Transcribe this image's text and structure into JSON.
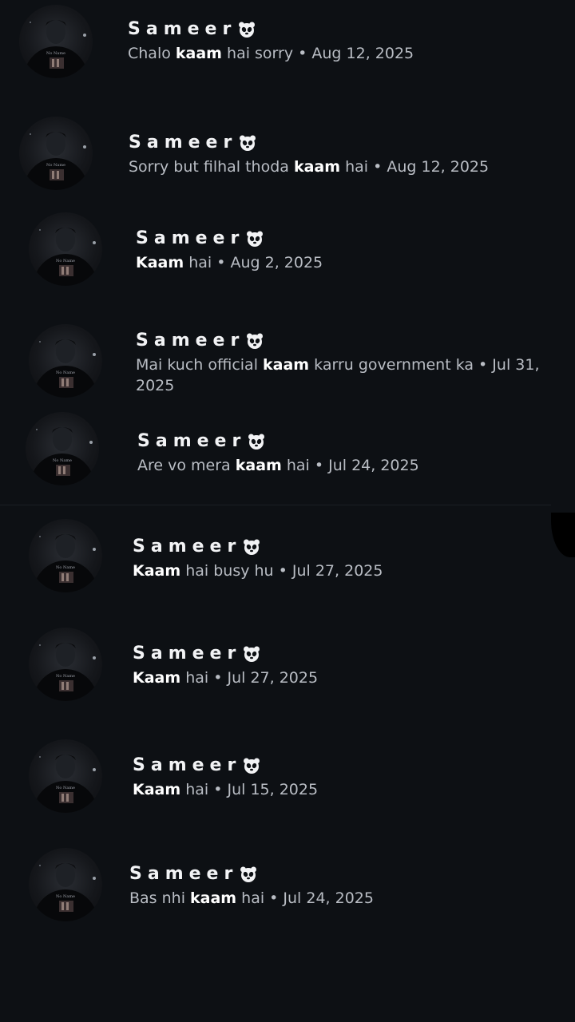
{
  "results": [
    {
      "name": "Sameer",
      "before": "Chalo ",
      "keyword": "kaam",
      "after": " hai sorry",
      "date": " • Aug 12, 2025"
    },
    {
      "name": "Sameer",
      "before": "Sorry but filhal thoda ",
      "keyword": "kaam",
      "after": " hai",
      "date": " • Aug 12, 2025"
    },
    {
      "name": "Sameer",
      "before": "",
      "keyword": "Kaam",
      "after": " hai",
      "date": " • Aug 2, 2025"
    },
    {
      "name": "Sameer",
      "before": "Mai kuch official ",
      "keyword": "kaam",
      "after": " karru government ka",
      "date": " • Jul 31, 2025"
    },
    {
      "name": "Sameer",
      "before": "Are vo mera ",
      "keyword": "kaam",
      "after": " hai",
      "date": " • Jul 24, 2025"
    },
    {
      "name": "Sameer",
      "before": "",
      "keyword": "Kaam",
      "after": " hai busy hu",
      "date": " • Jul 27, 2025"
    },
    {
      "name": "Sameer",
      "before": "",
      "keyword": "Kaam",
      "after": " hai",
      "date": " • Jul 27, 2025"
    },
    {
      "name": "Sameer",
      "before": "",
      "keyword": "Kaam",
      "after": " hai",
      "date": " • Jul 15, 2025"
    },
    {
      "name": "Sameer",
      "before": "Bas nhi ",
      "keyword": "kaam",
      "after": " hai",
      "date": " • Jul 24, 2025"
    }
  ],
  "avatar_caption": "No Name",
  "avatar_icon": "profile-photo",
  "name_emoji_icon": "panda-face-icon",
  "colors": {
    "background": "#0d1014",
    "name": "#f2f3f5",
    "snippet": "#b9bdc4",
    "keyword": "#ffffff"
  }
}
